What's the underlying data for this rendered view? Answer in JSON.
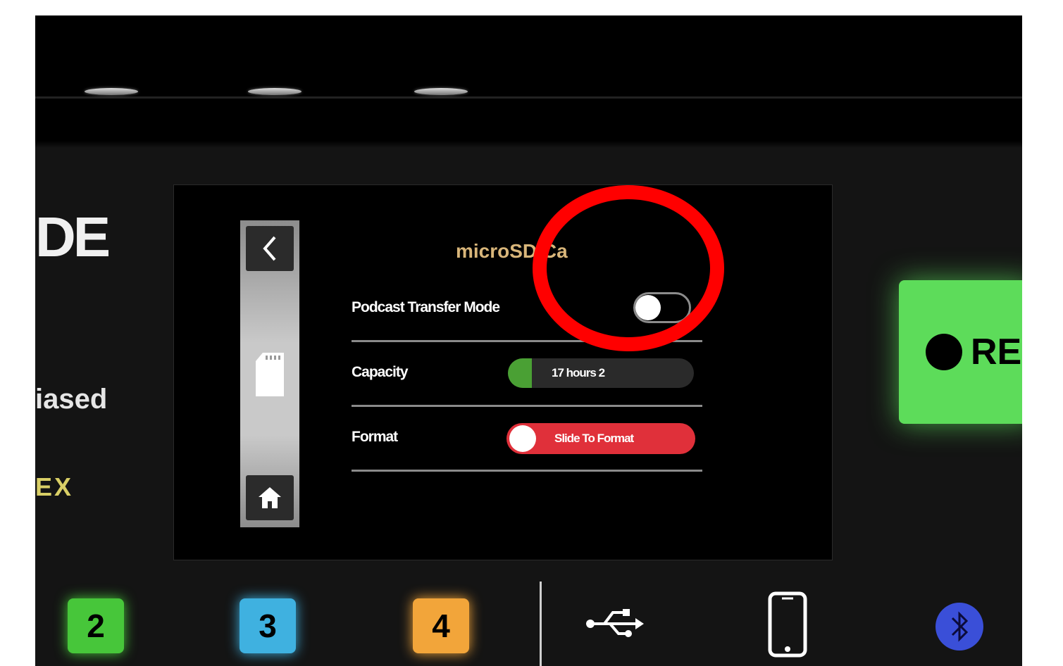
{
  "device": {
    "brand_partial": "DE",
    "tagline_partial": "iased",
    "model_partial": "EX"
  },
  "screen": {
    "title": "microSD Ca",
    "rows": [
      {
        "label": "Podcast Transfer Mode",
        "control": "toggle",
        "state": "off"
      },
      {
        "label": "Capacity",
        "value_text": "17 hours 2",
        "used_fraction": 0.13
      },
      {
        "label": "Format",
        "slider_text": "Slide To Format"
      }
    ],
    "sidebar": {
      "back_icon": "chevron-left-icon",
      "middle_icon": "sd-card-icon",
      "home_icon": "home-icon"
    }
  },
  "record_button": {
    "label": "RE"
  },
  "pads": [
    {
      "number": "2",
      "color": "#47c63a"
    },
    {
      "number": "3",
      "color": "#3fb1e0"
    },
    {
      "number": "4",
      "color": "#f2a53a"
    }
  ],
  "bottom_icons": [
    "usb-icon",
    "smartphone-icon",
    "bluetooth-icon"
  ],
  "annotation": {
    "color": "#ff0000",
    "shape": "ellipse-highlight"
  },
  "colors": {
    "accent_green": "#5ddc5a",
    "format_red": "#e0303a",
    "title_gold": "#d9b67a"
  }
}
